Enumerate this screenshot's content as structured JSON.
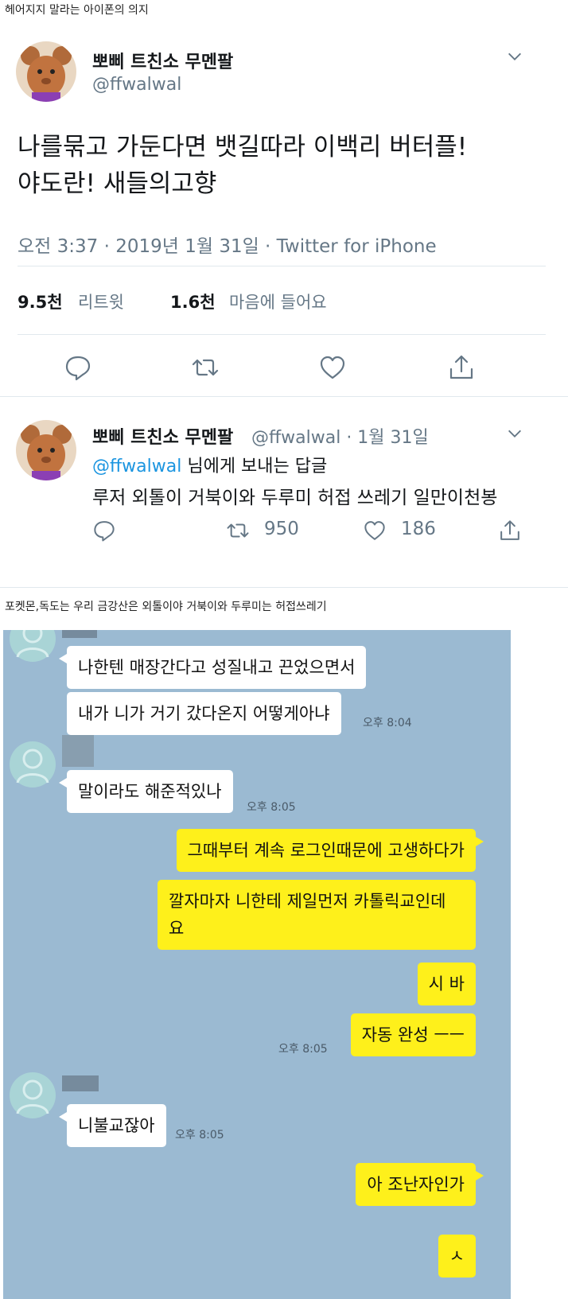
{
  "captions": {
    "top": "헤어지지 말라는 아이폰의 의지",
    "middle": "포켓몬,독도는 우리 금강산은 외톨이야 거북이와 두루미는 허접쓰레기"
  },
  "tweet": {
    "display_name": "뽀삐 트친소 무멘팔",
    "handle": "@ffwalwal",
    "text_line1": "나를묶고 가둔다면 뱃길따라 이백리 버터플!",
    "text_line2": "야도란! 새들의고향",
    "meta": "오전 3:37 · 2019년 1월 31일 · Twitter for iPhone",
    "retweet_count": "9.5천",
    "retweet_label": "리트윗",
    "like_count": "1.6천",
    "like_label": "마음에 들어요",
    "actions": [
      "reply-icon",
      "retweet-icon",
      "heart-icon",
      "share-icon"
    ]
  },
  "reply": {
    "display_name": "뽀삐 트친소 무멘팔",
    "handle_date": "@ffwalwal · 1월 31일",
    "reply_to_handle": "@ffwalwal",
    "reply_to_suffix": "님에게 보내는 답글",
    "text": "루저 외톨이 거북이와 두루미 허접 쓰레기 일만이천봉",
    "retweets": "950",
    "likes": "186"
  },
  "chat": {
    "background": "#9bbad2",
    "incoming_color": "#ffffff",
    "outgoing_color": "#fef01b",
    "messages": [
      {
        "text": "나한텐 매장간다고 성질내고 끈었으면서",
        "side": "in"
      },
      {
        "text": "내가 니가 거기 갔다온지 어떻게아냐",
        "side": "in",
        "time": "오후 8:04"
      },
      {
        "text": "말이라도 해준적있나",
        "side": "in",
        "time": "오후 8:05"
      },
      {
        "text": "그때부터 계속 로그인때문에 고생하다가",
        "side": "out"
      },
      {
        "text_line1": "깔자마자 니한테 제일먼저 카톨릭교인데",
        "text_line2": "요",
        "side": "out"
      },
      {
        "text": "시 바",
        "side": "out"
      },
      {
        "text": "자동 완성 ㅡㅡ",
        "side": "out",
        "time": "오후 8:05"
      },
      {
        "text": "니불교잖아",
        "side": "in",
        "time": "오후 8:05"
      },
      {
        "text": "아 조난자인가",
        "side": "out"
      },
      {
        "text": "ㅅ",
        "side": "out"
      }
    ]
  }
}
